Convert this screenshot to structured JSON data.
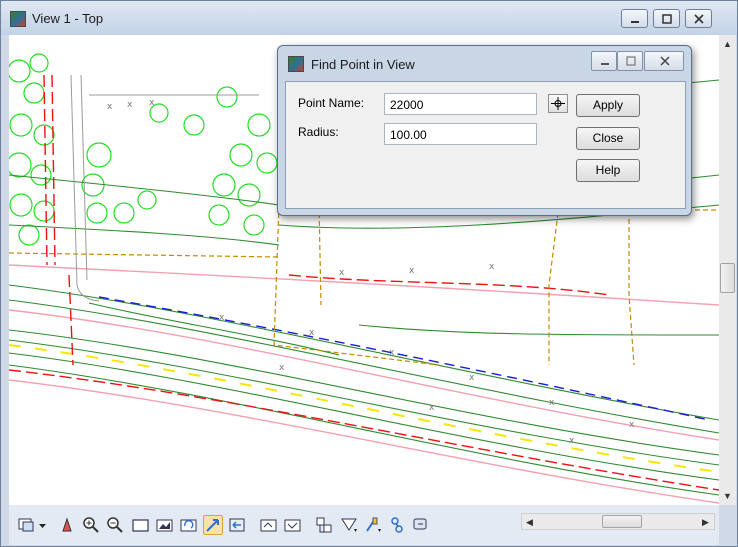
{
  "window": {
    "title": "View 1 - Top",
    "icon": "microstation-view-icon"
  },
  "dialog": {
    "title": "Find Point in View",
    "point_name_label": "Point Name:",
    "point_name_value": "22000",
    "radius_label": "Radius:",
    "radius_value": "100.00",
    "buttons": {
      "apply": "Apply",
      "close": "Close",
      "help": "Help"
    }
  },
  "view_toolbar": {
    "tools": [
      "view-attributes-icon",
      "update-view-icon",
      "zoom-in-icon",
      "zoom-out-icon",
      "window-area-icon",
      "fit-view-icon",
      "rotate-view-icon",
      "pan-view-icon",
      "view-previous-icon",
      "view-next-icon",
      "copy-view-icon",
      "clip-volume-icon",
      "display-set-icon",
      "camera-icon",
      "render-icon",
      "view-control-icon"
    ],
    "active_tool": "pan-view-icon"
  },
  "colors": {
    "contour": "#2e8b2e",
    "tree": "#22dd22",
    "property_line": "#c48a00",
    "road_edge": "#ee1111",
    "water_line": "#1a1add",
    "center_line": "#f5e800"
  }
}
